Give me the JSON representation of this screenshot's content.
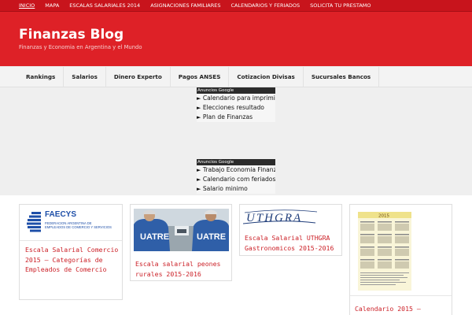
{
  "topnav": {
    "items": [
      "INICIO",
      "MAPA",
      "ESCALAS SALARIALES 2014",
      "ASIGNACIONES FAMILIARES",
      "CALENDARIOS Y FERIADOS",
      "SOLICITA TU PRESTAMO"
    ],
    "active_index": 0
  },
  "header": {
    "title": "Finanzas Blog",
    "description": "Finanzas y Economia en Argentina y el Mundo"
  },
  "mainnav": {
    "items": [
      "Rankings",
      "Salarios",
      "Dinero Experto",
      "Pagos ANSES",
      "Cotizacion Divisas",
      "Sucursales Bancos"
    ]
  },
  "ads": [
    {
      "heading": "Anuncios Google",
      "links": [
        "Calendario para imprimir",
        "Elecciones resultado",
        "Plan de Finanzas"
      ]
    },
    {
      "heading": "Anuncios Google",
      "links": [
        "Trabajo Economia Finanzas",
        "Calendario com feriados",
        "Salario minimo"
      ]
    }
  ],
  "ad_arrow": "►",
  "cards": [
    {
      "title": "Escala Salarial Comercio 2015 – Categorías de Empleados de Comercio",
      "logo_name": "FAECYS",
      "logo_sub": "FEDERACION ARGENTINA DE EMPLEADOS DE COMERCIO Y SERVICIOS"
    },
    {
      "title": "Escala salarial peones rurales 2015-2016",
      "shirt_text": "UATRE"
    },
    {
      "title": "Escala Salarial UTHGRA Gastronomicos 2015-2016",
      "logo_name": "UTHGRA"
    },
    {
      "title": "Calendario 2015 –",
      "calendar_year": "2015"
    }
  ],
  "colors": {
    "brand_red": "#de2127",
    "topbar_red": "#c8141c",
    "link_red": "#cc2229"
  }
}
